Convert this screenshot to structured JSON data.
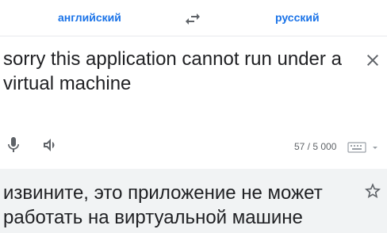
{
  "languages": {
    "source": "английский",
    "target": "русский"
  },
  "source": {
    "text": "sorry this application cannot run under a virtual machine",
    "char_count": "57 / 5 000"
  },
  "result": {
    "text": "извините, это приложение не может работать на виртуальной машине"
  },
  "colors": {
    "accent": "#1a73e8",
    "icon": "#5f6368",
    "result_bg": "#f1f3f4"
  },
  "icons": [
    "swap-languages-icon",
    "clear-icon",
    "microphone-icon",
    "speaker-icon",
    "keyboard-icon",
    "star-icon"
  ]
}
